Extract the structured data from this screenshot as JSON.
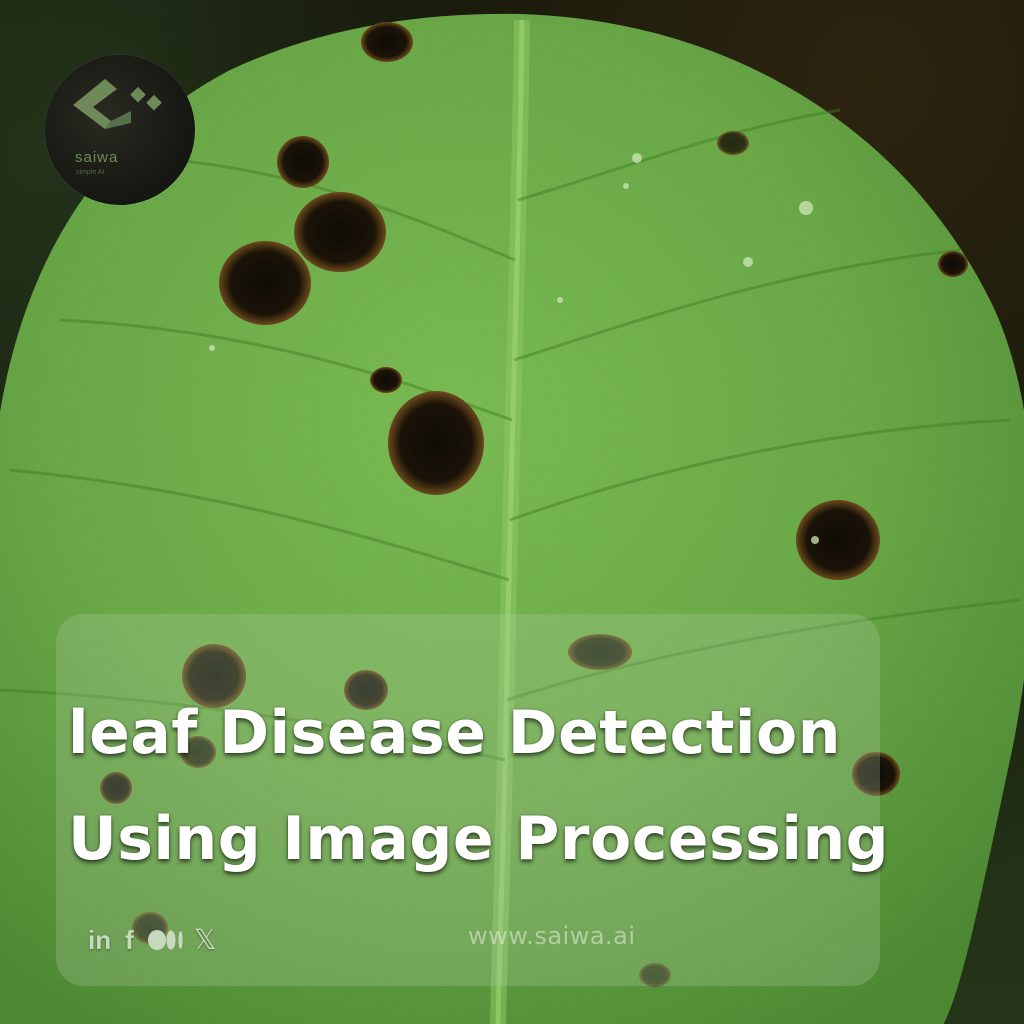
{
  "title": {
    "line1": "leaf Disease Detection",
    "line2": "Using Image Processing"
  },
  "logo": {
    "name": "saiwa",
    "tagline": "simple AI",
    "icon": "saiwa-logo-icon"
  },
  "footer": {
    "website": "www.saiwa.ai",
    "social": [
      {
        "icon": "linkedin-icon",
        "text": "in"
      },
      {
        "icon": "facebook-icon",
        "text": "f"
      },
      {
        "icon": "medium-icon",
        "text": ""
      },
      {
        "icon": "x-icon",
        "text": "𝕏"
      }
    ]
  },
  "colors": {
    "leaf": "#5fa53a",
    "lesion": "#1a1208",
    "overlay": "#afcda0",
    "text": "#ffffff"
  }
}
